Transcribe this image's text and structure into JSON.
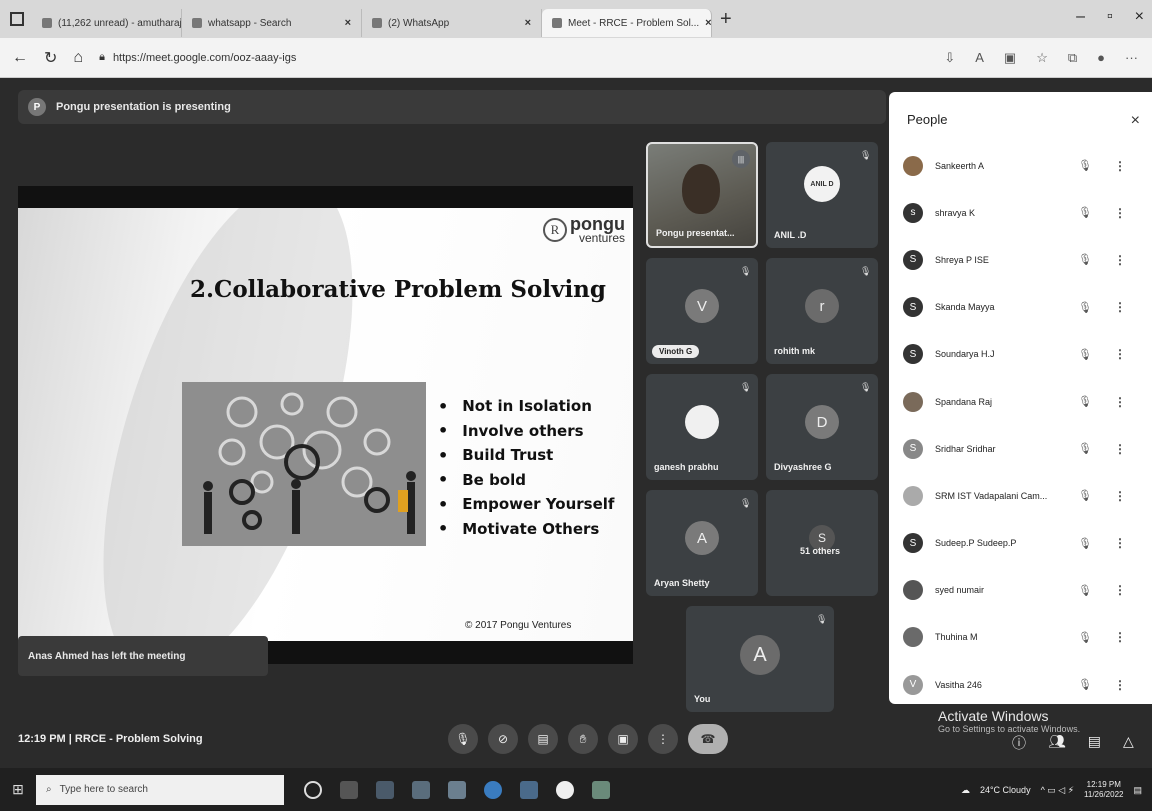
{
  "browser": {
    "tabs": [
      {
        "label": "(11,262 unread) - amutharaj@..."
      },
      {
        "label": "whatsapp - Search"
      },
      {
        "label": "(2) WhatsApp"
      },
      {
        "label": "Meet - RRCE - Problem Sol..."
      }
    ],
    "url": "https://meet.google.com/ooz-aaay-igs"
  },
  "meet": {
    "presenting_avatar": "P",
    "presenting_text": "Pongu presentation is presenting",
    "slide": {
      "logo_brand": "pongu",
      "logo_sub": "ventures",
      "title": "2.Collaborative Problem Solving",
      "bullets": [
        "Not in Isolation",
        "Involve others",
        "Build Trust",
        "Be bold",
        "Empower Yourself",
        "Motivate Others"
      ],
      "copyright": "© 2017 Pongu Ventures"
    },
    "toast": "Anas Ahmed has left the meeting",
    "tiles": [
      {
        "name": "Pongu presentat...",
        "initial": ""
      },
      {
        "name": "ANIL .D",
        "initial": "ANIL D"
      },
      {
        "name": "Vinoth G",
        "initial": "V"
      },
      {
        "name": "rohith mk",
        "initial": "r"
      },
      {
        "name": "ganesh prabhu",
        "initial": ""
      },
      {
        "name": "Divyashree G",
        "initial": "D"
      },
      {
        "name": "Aryan Shetty",
        "initial": "A"
      },
      {
        "name": "51 others",
        "initial": "S"
      },
      {
        "name": "You",
        "initial": "A"
      }
    ],
    "footer": "12:19 PM  |  RRCE - Problem Solving"
  },
  "people": {
    "title": "People",
    "list": [
      {
        "name": "Sankeerth A",
        "initial": ""
      },
      {
        "name": "shravya K",
        "initial": "s"
      },
      {
        "name": "Shreya P ISE",
        "initial": "S"
      },
      {
        "name": "Skanda Mayya",
        "initial": "S"
      },
      {
        "name": "Soundarya H.J",
        "initial": "S"
      },
      {
        "name": "Spandana Raj",
        "initial": ""
      },
      {
        "name": "Sridhar Sridhar",
        "initial": "S"
      },
      {
        "name": "SRM IST Vadapalani Cam...",
        "initial": ""
      },
      {
        "name": "Sudeep.P Sudeep.P",
        "initial": "S"
      },
      {
        "name": "syed numair",
        "initial": ""
      },
      {
        "name": "Thuhina M",
        "initial": ""
      },
      {
        "name": "Vasitha 246",
        "initial": "V"
      }
    ]
  },
  "windows": {
    "activate_title": "Activate Windows",
    "activate_sub": "Go to Settings to activate Windows.",
    "search_placeholder": "Type here to search",
    "weather": "24°C Cloudy",
    "time": "12:19 PM",
    "date": "11/26/2022"
  },
  "icons": {
    "mic_off": "mic-off-icon",
    "more": "more-vert-icon",
    "close": "close-icon"
  },
  "colors": {
    "meet_bg": "#2b2b2b",
    "tile_bg": "#3c4043",
    "panel_bg": "#ffffff"
  }
}
